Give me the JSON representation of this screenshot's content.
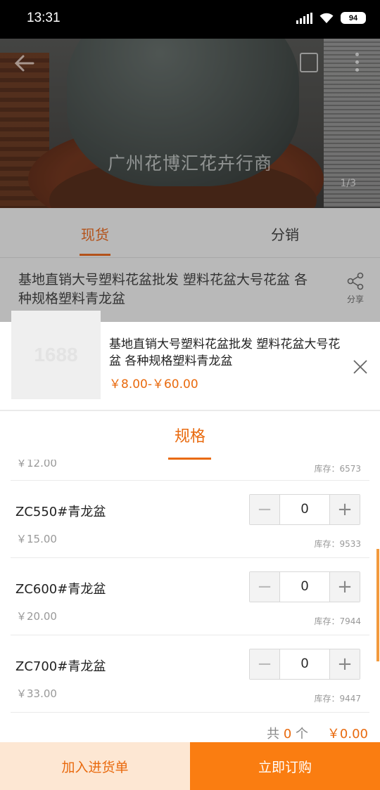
{
  "status": {
    "time": "13:31",
    "battery": "94"
  },
  "hero": {
    "watermark": "广州花博汇花卉行商",
    "counter": "1/3"
  },
  "page_tabs": [
    {
      "label": "现货"
    },
    {
      "label": "分销"
    }
  ],
  "page_title": "基地直销大号塑料花盆批发 塑料花盆大号花盆 各种规格塑料青龙盆",
  "share_label": "分享",
  "sheet": {
    "thumb_text": "1688",
    "title": "基地直销大号塑料花盆批发 塑料花盆大号花盆 各种规格塑料青龙盆",
    "price_range": "￥8.00-￥60.00",
    "spec_tab": "规格"
  },
  "partial_row": {
    "price": "￥12.00",
    "stock": "库存：6573"
  },
  "items": [
    {
      "name": "ZC550#青龙盆",
      "price": "￥15.00",
      "qty": "0",
      "stock": "库存：9533"
    },
    {
      "name": "ZC600#青龙盆",
      "price": "￥20.00",
      "qty": "0",
      "stock": "库存：7944"
    },
    {
      "name": "ZC700#青龙盆",
      "price": "￥33.00",
      "qty": "0",
      "stock": "库存：9447"
    }
  ],
  "summary": {
    "count_prefix": "共",
    "count": "0",
    "count_unit": "个",
    "total": "￥0.00"
  },
  "actions": {
    "add_to_cart": "加入进货单",
    "buy_now": "立即订购"
  },
  "colors": {
    "accent": "#e96a0e",
    "buy_bg": "#fa7d11",
    "cart_bg": "#fde7d3"
  }
}
